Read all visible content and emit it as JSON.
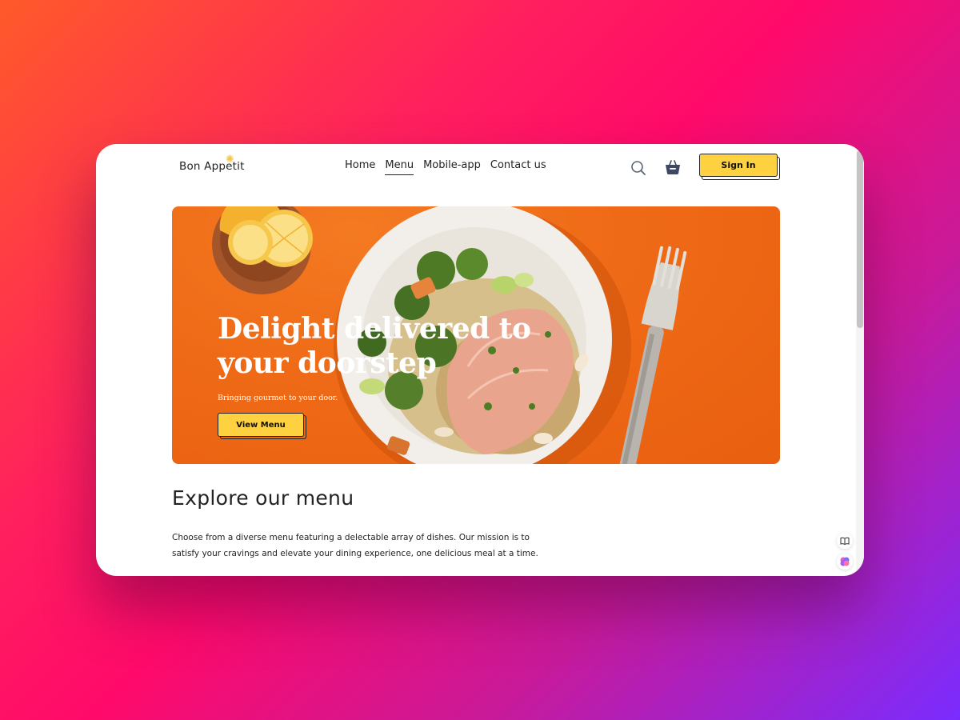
{
  "brand": {
    "name": "Bon Appetit"
  },
  "nav": {
    "items": [
      {
        "label": "Home"
      },
      {
        "label": "Menu",
        "active": true
      },
      {
        "label": "Mobile-app"
      },
      {
        "label": "Contact us"
      }
    ]
  },
  "header": {
    "signin_label": "Sign In",
    "search_icon": "search-icon",
    "cart_icon": "basket-icon"
  },
  "hero": {
    "title": "Delight delivered to your doorstep",
    "subtitle": "Bringing gourmet to your door.",
    "cta_label": "View Menu"
  },
  "explore": {
    "title": "Explore our menu",
    "text": "Choose from a diverse menu featuring a delectable array of dishes. Our mission is to satisfy your cravings and elevate your dining experience, one delicious meal at a time."
  },
  "colors": {
    "accent": "#fdd13f",
    "hero_bg": "#ef6a16",
    "text": "#222222"
  }
}
